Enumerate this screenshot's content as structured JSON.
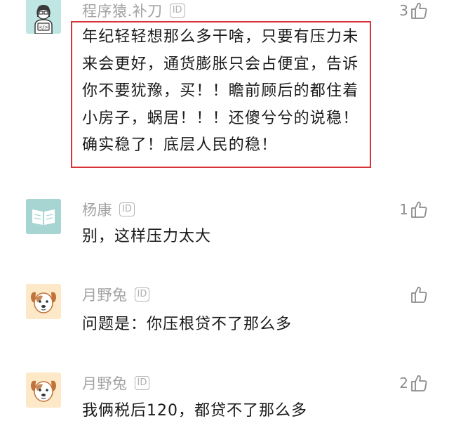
{
  "comments": [
    {
      "username": "程序猿.补刀",
      "badge": "ID",
      "likes": "3",
      "avatar_icon": "programmer-avatar-icon",
      "lines": [
        "年纪轻轻想那么多干啥，只要有压力未",
        "来会更好，通货膨胀只会占便宜，告诉",
        "你不要犹豫，买！！瞻前顾后的都住着",
        "小房子，蜗居！！！还傻兮兮的说稳！",
        "确实稳了！底层人民的稳！"
      ]
    },
    {
      "username": "杨康",
      "badge": "ID",
      "likes": "1",
      "avatar_icon": "book-avatar-icon",
      "text": "别，这样压力太大"
    },
    {
      "username": "月野兔",
      "badge": "ID",
      "likes": "",
      "avatar_icon": "dog-avatar-icon",
      "text": "问题是：你压根贷不了那么多"
    },
    {
      "username": "月野兔",
      "badge": "ID",
      "likes": "2",
      "avatar_icon": "dog-avatar-icon",
      "text": "我俩税后120，都贷不了那么多"
    }
  ],
  "colors": {
    "highlight_border": "#d9323a",
    "username": "#a3a3a3",
    "text": "#1a1a1a"
  }
}
